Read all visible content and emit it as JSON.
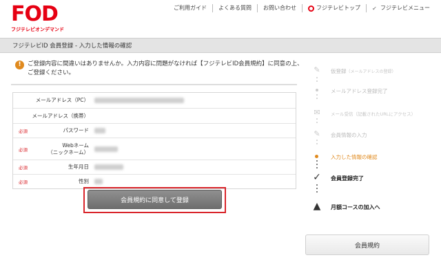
{
  "header": {
    "logo_main": "FOD",
    "logo_sub": "フジテレビオンデマンド",
    "nav": [
      {
        "label": "ご利用ガイド"
      },
      {
        "label": "よくある質問"
      },
      {
        "label": "お問い合わせ"
      },
      {
        "label": "フジテレビトップ",
        "icon": "fujitv-logo-icon"
      },
      {
        "label": "フジテレビメニュー",
        "icon": "chevron-down-icon"
      }
    ]
  },
  "page_title": "フジテレビID 会員登録 - 入力した情報の確認",
  "notice": {
    "icon": "exclamation-icon",
    "text": "ご登録内容に間違いはありませんか。入力内容に問題がなければ【フジテレビID会員規約】に同意の上、ご登録ください。"
  },
  "form": {
    "required_label": "必須",
    "rows": [
      {
        "label": "メールアドレス（PC）",
        "required": false
      },
      {
        "label": "メールアドレス（携帯）",
        "required": false
      },
      {
        "label": "パスワード",
        "required": true
      },
      {
        "label_line1": "Webネーム",
        "label_line2": "（ニックネーム）",
        "required": true
      },
      {
        "label": "生年月日",
        "required": true
      },
      {
        "label": "性別",
        "required": true
      }
    ]
  },
  "register_button": "会員規約に同意して登録",
  "steps": [
    {
      "label": "仮登録",
      "note": "（メールアドレスの登録）",
      "icon": "pencil-icon"
    },
    {
      "label": "メールアドレス登録完了"
    },
    {
      "label": "メール受信（記載されたURLにアクセス）",
      "icon": "mail-icon"
    },
    {
      "label": "会員情報の入力",
      "icon": "pencil-icon"
    },
    {
      "label": "入力した情報の確認",
      "active": true
    },
    {
      "label": "会員登録完了",
      "icon": "checkmark-icon"
    },
    {
      "label": "月額コースの加入へ",
      "icon": "road-icon"
    }
  ],
  "terms_button": "会員規約",
  "colors": {
    "brand": "#e60012",
    "accent": "#e08a1e",
    "highlight": "#d9242a"
  }
}
